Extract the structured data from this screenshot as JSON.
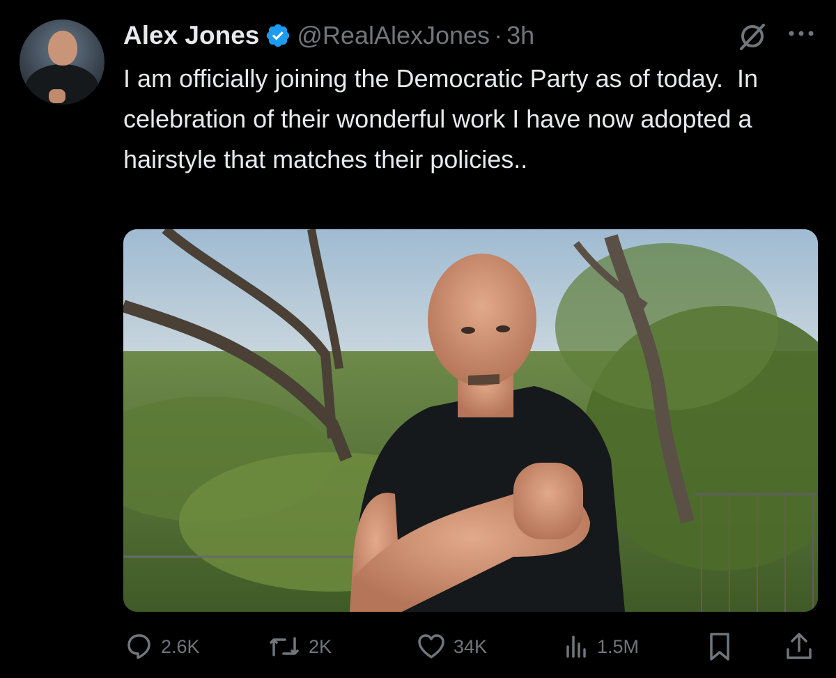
{
  "post": {
    "author_name": "Alex Jones",
    "handle": "@RealAlexJones",
    "separator": "·",
    "time": "3h",
    "text": "I am officially joining the Democratic Party as of today.  In celebration of their wonderful work I have now adopted a hairstyle that matches their policies..",
    "verified_color": "#1d9bf0"
  },
  "actions": {
    "replies": "2.6K",
    "reposts": "2K",
    "likes": "34K",
    "views": "1.5M"
  },
  "icons": {
    "verified": "verified-badge-icon",
    "grok": "grok-icon",
    "more": "more-icon",
    "reply": "reply-icon",
    "repost": "repost-icon",
    "like": "heart-icon",
    "views": "views-icon",
    "bookmark": "bookmark-icon",
    "share": "share-icon"
  }
}
